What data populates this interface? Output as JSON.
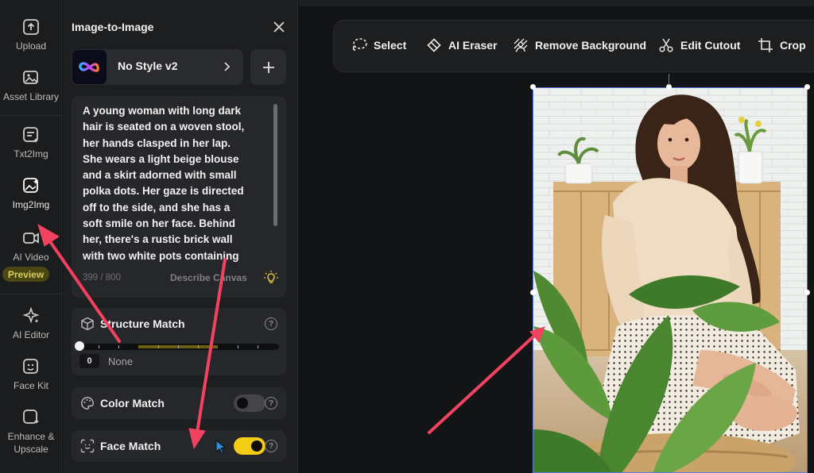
{
  "rail": {
    "items": [
      {
        "label": "Upload",
        "icon": "upload-icon"
      },
      {
        "label": "Asset Library",
        "icon": "asset-library-icon"
      },
      {
        "label": "Txt2Img",
        "icon": "txt2img-icon"
      },
      {
        "label": "Img2Img",
        "icon": "img2img-icon"
      },
      {
        "label": "AI Video",
        "icon": "ai-video-icon"
      },
      {
        "label": "AI Editor",
        "icon": "ai-editor-icon"
      },
      {
        "label": "Face Kit",
        "icon": "face-kit-icon"
      },
      {
        "label": "Enhance &",
        "label2": "Upscale",
        "icon": "enhance-icon"
      }
    ],
    "preview_badge": "Preview"
  },
  "panel": {
    "title": "Image-to-Image",
    "style_name": "No Style v2",
    "prompt": "A young woman with long dark hair is seated on a woven stool, her hands clasped in her lap. She wears a light beige blouse and a skirt adorned with small polka dots. Her gaze is directed off to the side, and she has a soft smile on her face. Behind her, there's a rustic brick wall with two white pots containing greenery. The",
    "char_count": "399 / 800",
    "describe_label": "Describe Canvas",
    "structure_match": {
      "label": "Structure Match",
      "value": "0",
      "value_label": "None"
    },
    "color_match": {
      "label": "Color Match",
      "enabled": false
    },
    "face_match": {
      "label": "Face Match",
      "enabled": true
    }
  },
  "toolbar": {
    "tools": [
      {
        "label": "Select",
        "icon": "select-lasso-icon"
      },
      {
        "label": "AI Eraser",
        "icon": "eraser-icon"
      },
      {
        "label": "Remove Background",
        "icon": "remove-background-icon"
      },
      {
        "label": "Edit Cutout",
        "icon": "scissors-icon"
      },
      {
        "label": "Crop",
        "icon": "crop-icon"
      }
    ]
  },
  "colors": {
    "accent_yellow": "#f5cc15",
    "annotation_arrow": "#f2425f",
    "selection_blue": "#5b7bd6"
  }
}
